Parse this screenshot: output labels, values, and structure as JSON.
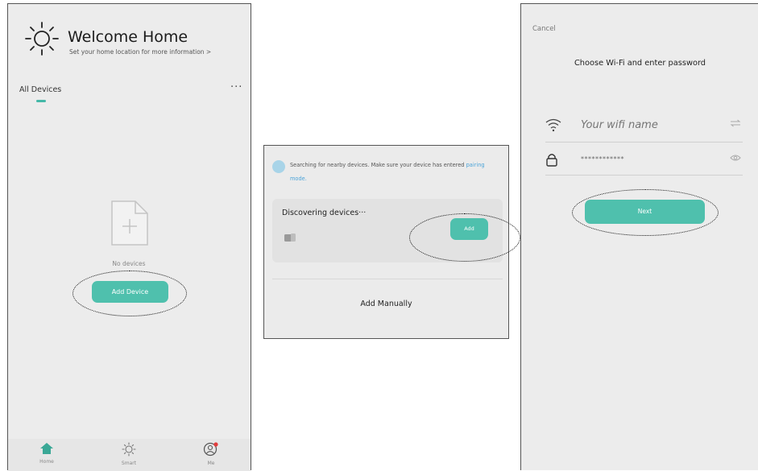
{
  "panel1": {
    "title": "Welcome Home",
    "subtitle": "Set your home location for more information >",
    "tab_all_devices": "All Devices",
    "more_label": "···",
    "no_devices_label": "No devices",
    "add_device_label": "Add Device",
    "tabbar": [
      {
        "label": "Home",
        "icon": "home-icon"
      },
      {
        "label": "Smart",
        "icon": "sun-icon"
      },
      {
        "label": "Me",
        "icon": "user-icon"
      }
    ]
  },
  "panel2": {
    "search_message": "Searching for nearby devices. Make sure your device has entered",
    "search_link": "pairing mode.",
    "discovering_label": "Discovering devices···",
    "add_label": "Add",
    "add_manually_label": "Add Manually"
  },
  "panel3": {
    "cancel_label": "Cancel",
    "title": "Choose Wi-Fi and enter password",
    "wifi_placeholder": "Your wifi name",
    "password_value": "************",
    "next_label": "Next"
  },
  "colors": {
    "accent": "#4fc0ad",
    "background": "#ececec",
    "link": "#4aa3d8",
    "notification": "#e23c3c"
  }
}
